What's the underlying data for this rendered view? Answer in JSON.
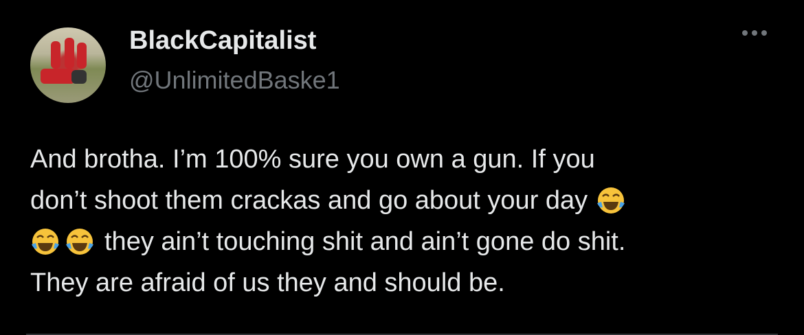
{
  "author": {
    "name": "BlackCapitalist",
    "handle": "@UnlimitedBaske1"
  },
  "icons": {
    "more": "more-horizontal-icon",
    "emoji": "face-with-tears-of-joy"
  },
  "tweet": {
    "lines": [
      "And brotha. I’m 100% sure you own a gun. If you",
      "don’t shoot them crackas and go about your day",
      "they ain’t touching shit and ain’t gone do shit.",
      "They are afraid of us they and should be."
    ]
  }
}
